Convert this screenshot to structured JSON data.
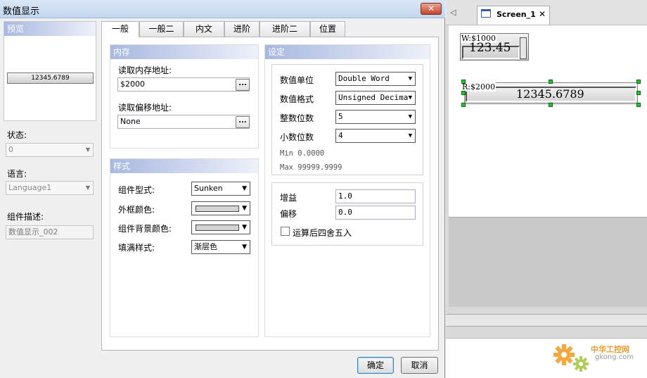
{
  "dialog": {
    "title": "数值显示",
    "close_glyph": "✕",
    "preview_label": "预览",
    "preview_value": "12345.6789",
    "state_label": "状态:",
    "state_value": "0",
    "language_label": "语言:",
    "language_value": "Language1",
    "description_label": "组件描述:",
    "description_value": "数值显示_002",
    "tabs": [
      "一般",
      "一般二",
      "内文",
      "进阶",
      "进阶二",
      "位置"
    ],
    "memory": {
      "title": "内存",
      "read_address_label": "读取内存地址:",
      "read_address_value": "$2000",
      "offset_address_label": "读取偏移地址:",
      "offset_address_value": "None",
      "browse_label": "..."
    },
    "style": {
      "title": "样式",
      "component_style_label": "组件型式:",
      "component_style_value": "Sunken",
      "border_color_label": "外框颜色:",
      "bg_color_label": "组件背景颜色:",
      "fill_style_label": "填满样式:",
      "fill_style_value": "渐层色"
    },
    "settings": {
      "title": "设定",
      "unit_label": "数值单位",
      "unit_value": "Double Word",
      "format_label": "数值格式",
      "format_value": "Unsigned Decima",
      "int_digits_label": "整数位数",
      "int_digits_value": "5",
      "dec_digits_label": "小数位数",
      "dec_digits_value": "4",
      "min_text": "Min 0.0000",
      "max_text": "Max 99999.9999",
      "gain_label": "增益",
      "gain_value": "1.0",
      "offset_label": "偏移",
      "offset_value": "0.0",
      "round_label": "运算后四舍五入"
    },
    "ok_label": "确定",
    "cancel_label": "取消"
  },
  "editor": {
    "screen_tab_label": "Screen_1",
    "tab_close_glyph": "✕",
    "nav_arrow": "◁",
    "write_widget_label": "W:$1000",
    "write_widget_value": "123.45",
    "read_widget_label": "R:$2000",
    "read_widget_value": "12345.6789"
  },
  "watermark": {
    "name": "中华工控网",
    "url": "gkong.com"
  },
  "colors": {
    "section_head": "#a8b8e0",
    "handle_green": "#22c42a",
    "watermark_orange": "#f29a1f"
  }
}
